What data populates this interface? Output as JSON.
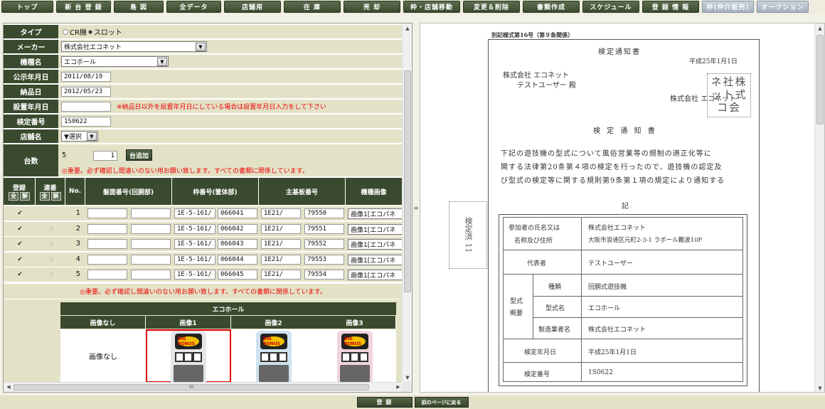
{
  "nav": [
    "トップ",
    "新 台 登 録",
    "島 図",
    "全データ",
    "店舗用",
    "在 庫",
    "売 却",
    "枠・店舗移動",
    "変更＆削除",
    "書類作成",
    "スケジュール",
    "登 録 情 報",
    "枠(仲介販売)",
    "オークション"
  ],
  "form": {
    "type_label": "タイプ",
    "type_opt1": "CR機",
    "type_opt2": "スロット",
    "maker_label": "メーカー",
    "maker_value": "株式会社エコネット",
    "model_label": "機種名",
    "model_value": "エコホール",
    "announce_label": "公示年月日",
    "announce_value": "2011/08/19",
    "delivery_label": "納品日",
    "delivery_value": "2012/05/23",
    "install_label": "設置年月日",
    "install_value": "",
    "install_note": "※納品日以外を設置年月日にしている場合は設置年月日入力をして下さい",
    "inspect_label": "検定番号",
    "inspect_value": "1S0622",
    "store_label": "店舗名",
    "store_value": "▼選択",
    "count_label": "台数",
    "count_value": "5",
    "add_qty": "1",
    "add_button": "台追加",
    "warning": "◎重要。必ず確認し間違いのない用お願い致します。すべての書類に関係しています。"
  },
  "table": {
    "headers": {
      "reg": "登録",
      "seq": "連番",
      "all": "全",
      "clear": "解",
      "no": "No.",
      "board": "盤面番号(回胴部)",
      "frame": "枠番号(筐体部)",
      "main": "主基板番号",
      "image": "機種画像"
    },
    "rows": [
      {
        "no": "1",
        "frame1": "1E-5-161/",
        "frame2": "066041",
        "main1": "1E21/",
        "main2": "79550",
        "img": "画像1[エコパネ"
      },
      {
        "no": "2",
        "frame1": "1E-5-161/",
        "frame2": "066042",
        "main1": "1E21/",
        "main2": "79551",
        "img": "画像1[エコパネ"
      },
      {
        "no": "3",
        "frame1": "1E-5-161/",
        "frame2": "066043",
        "main1": "1E21/",
        "main2": "79552",
        "img": "画像1[エコパネ"
      },
      {
        "no": "4",
        "frame1": "1E-5-161/",
        "frame2": "066044",
        "main1": "1E21/",
        "main2": "79553",
        "img": "画像1[エコパネ"
      },
      {
        "no": "5",
        "frame1": "1E-5-161/",
        "frame2": "066045",
        "main1": "1E21/",
        "main2": "79554",
        "img": "画像1[エコパネ"
      }
    ],
    "warning2": "◎重要。必ず確認し間違いのない用お願い致します。すべての書類に関係しています。"
  },
  "images": {
    "title": "エコホール",
    "cols": [
      "画像なし",
      "画像1",
      "画像2",
      "画像3"
    ],
    "none_label": "画像なし",
    "logo_text": "BIG BONUS",
    "colors": [
      "#e6e6ea",
      "#cfe2f0",
      "#f0d4dc"
    ],
    "selected_color": "#e00000"
  },
  "doc": {
    "form_no": "別記様式第16号（第９条関係）",
    "heading": "検定通知書",
    "date": "平成25年1月1日",
    "to_company": "株式会社 エコネット",
    "to_user": "テストユーザー 殿",
    "from_company": "株式会社 エコネット",
    "stamp": "ネ社株 ット式 コ会",
    "title": "検 定 通 知 書",
    "body1": "下記の遊技機の型式について風俗営業等の規制の適正化等に",
    "body2": "関する法律第20条第４項の検定を行ったので、遊技機の認定及",
    "body3": "び型式の検定等に関する規則第9条第１項の規定により通知する",
    "ki": "記",
    "t_name_label1": "参加者の氏名又は",
    "t_name_label2": "名称及び住所",
    "t_name1": "株式会社エコネット",
    "t_name2": "大阪市浪速区元町2-3-1 ラポール難波10F",
    "t_rep_label": "代表者",
    "t_rep": "テストユーザー",
    "t_type_label1": "型式",
    "t_type_label2": "概要",
    "t_kind_label": "種類",
    "t_kind": "回胴式遊技機",
    "t_model_label": "型式名",
    "t_model": "エコホール",
    "t_maker_label": "製造業者名",
    "t_maker": "株式会社エコネット",
    "t_date_label": "検定年月日",
    "t_date": "平成25年1月1日",
    "t_no_label": "検定番号",
    "t_no": "1S0622",
    "side_stamp": "検定済 11"
  },
  "bottom": {
    "register": "登 録",
    "back": "前のページに戻る"
  },
  "scroll": {
    "hmid": "III"
  }
}
